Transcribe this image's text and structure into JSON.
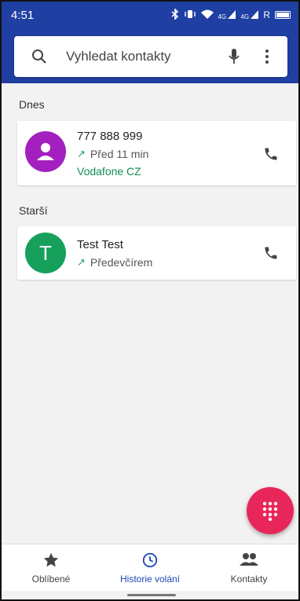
{
  "status": {
    "time": "4:51",
    "icons": [
      "bluetooth-icon",
      "vibrate-icon",
      "wifi-icon",
      "signal-4g-icon",
      "signal-4g-icon",
      "r-icon",
      "battery-icon"
    ],
    "net_label_1": "4G",
    "net_label_2": "4G",
    "roaming": "R"
  },
  "search": {
    "placeholder": "Vyhledat kontakty"
  },
  "sections": {
    "today": "Dnes",
    "older": "Starší"
  },
  "calls": [
    {
      "number": "777 888 999",
      "when": "Před 11 min",
      "carrier": "Vodafone CZ",
      "avatar_color": "#a31fbf"
    },
    {
      "name": "Test Test",
      "when": "Předevčírem",
      "initial": "T",
      "avatar_color": "#16a05c"
    }
  ],
  "nav": {
    "favorites": "Oblíbené",
    "history": "Historie volání",
    "contacts": "Kontakty"
  },
  "colors": {
    "header": "#1f3fa3",
    "fab": "#e8265a",
    "active": "#1f47b8",
    "carrier": "#128c5a"
  }
}
